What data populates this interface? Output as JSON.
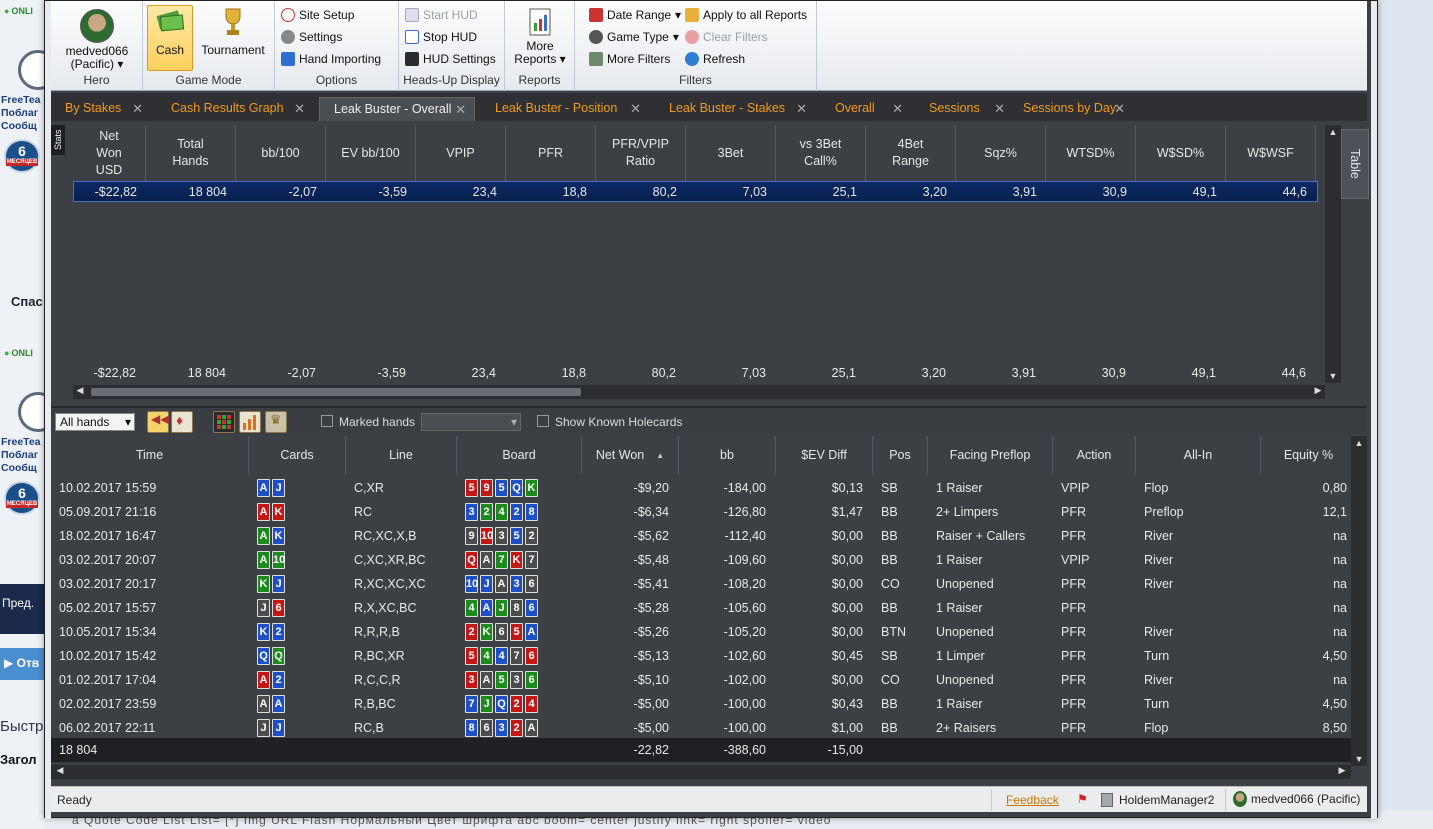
{
  "background": {
    "online": "ONLI",
    "freeteam_lines": [
      "FreeTea",
      "Поблаг",
      "Сообщ"
    ],
    "badge": {
      "num": "6",
      "label": "МЕСЯЦЕВ"
    },
    "spas": "Спас",
    "pred": "Пред.",
    "otv": "Отв",
    "bystr": "Быстр",
    "zagol": "Загол",
    "bottom_bar": "ā   Quote   Code   List   List=   [*]   Img   URL   Flash    Нормальный    Цвет шрифта   abc   boom=   center   justify   link=   right   spoiler=   video"
  },
  "ribbon": {
    "hero": {
      "name": "medved066",
      "site": "(Pacific)",
      "label": "Hero"
    },
    "game_mode": {
      "cash": "Cash",
      "tournament": "Tournament",
      "label": "Game Mode"
    },
    "options": {
      "site_setup": "Site Setup",
      "settings": "Settings",
      "hand_importing": "Hand Importing",
      "label": "Options"
    },
    "hud": {
      "start": "Start HUD",
      "stop": "Stop HUD",
      "settings": "HUD Settings",
      "label": "Heads-Up Display"
    },
    "reports": {
      "more1": "More",
      "more2": "Reports",
      "label": "Reports"
    },
    "filters": {
      "date_range": "Date Range",
      "apply_all": "Apply to all Reports",
      "game_type": "Game Type",
      "clear": "Clear Filters",
      "more": "More Filters",
      "refresh": "Refresh",
      "label": "Filters"
    }
  },
  "tabs": [
    "By Stakes",
    "Cash Results Graph",
    "Leak Buster - Overall",
    "Leak Buster - Position",
    "Leak Buster - Stakes",
    "Overall",
    "Sessions",
    "Sessions by Day"
  ],
  "stats": {
    "side_label": "Stats",
    "table_label": "Table",
    "headers": [
      [
        "Net",
        "Won",
        "USD"
      ],
      [
        "Total",
        "Hands"
      ],
      [
        "bb/100"
      ],
      [
        "EV bb/100"
      ],
      [
        "VPIP"
      ],
      [
        "PFR"
      ],
      [
        "PFR/VPIP",
        "Ratio"
      ],
      [
        "3Bet"
      ],
      [
        "vs 3Bet",
        "Call%"
      ],
      [
        "4Bet",
        "Range"
      ],
      [
        "Sqz%"
      ],
      [
        "WTSD%"
      ],
      [
        "W$SD%"
      ],
      [
        "W$WSF"
      ]
    ],
    "row": [
      "-$22,82",
      "18 804",
      "-2,07",
      "-3,59",
      "23,4",
      "18,8",
      "80,2",
      "7,03",
      "25,1",
      "3,20",
      "3,91",
      "30,9",
      "49,1",
      "44,6"
    ],
    "total": [
      "-$22,82",
      "18 804",
      "-2,07",
      "-3,59",
      "23,4",
      "18,8",
      "80,2",
      "7,03",
      "25,1",
      "3,20",
      "3,91",
      "30,9",
      "49,1",
      "44,6"
    ]
  },
  "hand_toolbar": {
    "filter": "All hands",
    "marked": "Marked hands",
    "known": "Show Known Holecards"
  },
  "hands": {
    "headers": [
      "Time",
      "Cards",
      "Line",
      "Board",
      "Net Won",
      "bb",
      "$EV Diff",
      "Pos",
      "Facing Preflop",
      "Action",
      "All-In",
      "Equity %"
    ],
    "rows": [
      {
        "time": "10.02.2017 15:59",
        "cards": [
          [
            "A",
            "d"
          ],
          [
            "J",
            "d"
          ]
        ],
        "line": "C,XR",
        "board": [
          [
            "5",
            "h"
          ],
          [
            "9",
            "h"
          ],
          [
            "5",
            "d"
          ],
          [
            "Q",
            "d"
          ],
          [
            "K",
            "c"
          ]
        ],
        "net": "-$9,20",
        "bb": "-184,00",
        "ev": "$0,13",
        "pos": "SB",
        "facing": "1 Raiser",
        "action": "VPIP",
        "allin": "Flop",
        "eq": "0,80"
      },
      {
        "time": "05.09.2017 21:16",
        "cards": [
          [
            "A",
            "h"
          ],
          [
            "K",
            "h"
          ]
        ],
        "line": "RC",
        "board": [
          [
            "3",
            "d"
          ],
          [
            "2",
            "c"
          ],
          [
            "4",
            "c"
          ],
          [
            "2",
            "d"
          ],
          [
            "8",
            "d"
          ]
        ],
        "net": "-$6,34",
        "bb": "-126,80",
        "ev": "$1,47",
        "pos": "BB",
        "facing": "2+ Limpers",
        "action": "PFR",
        "allin": "Preflop",
        "eq": "12,1"
      },
      {
        "time": "18.02.2017 16:47",
        "cards": [
          [
            "A",
            "c"
          ],
          [
            "K",
            "d"
          ]
        ],
        "line": "RC,XC,X,B",
        "board": [
          [
            "9",
            "s"
          ],
          [
            "10",
            "h"
          ],
          [
            "3",
            "s"
          ],
          [
            "5",
            "d"
          ],
          [
            "2",
            "s"
          ]
        ],
        "net": "-$5,62",
        "bb": "-112,40",
        "ev": "$0,00",
        "pos": "BB",
        "facing": "Raiser + Callers",
        "action": "PFR",
        "allin": "River",
        "eq": "na"
      },
      {
        "time": "03.02.2017 20:07",
        "cards": [
          [
            "A",
            "c"
          ],
          [
            "10",
            "c"
          ]
        ],
        "line": "C,XC,XR,BC",
        "board": [
          [
            "Q",
            "h"
          ],
          [
            "A",
            "s"
          ],
          [
            "7",
            "c"
          ],
          [
            "K",
            "h"
          ],
          [
            "7",
            "s"
          ]
        ],
        "net": "-$5,48",
        "bb": "-109,60",
        "ev": "$0,00",
        "pos": "BB",
        "facing": "1 Raiser",
        "action": "VPIP",
        "allin": "River",
        "eq": "na"
      },
      {
        "time": "03.02.2017 20:17",
        "cards": [
          [
            "K",
            "c"
          ],
          [
            "J",
            "d"
          ]
        ],
        "line": "R,XC,XC,XC",
        "board": [
          [
            "10",
            "d"
          ],
          [
            "J",
            "d"
          ],
          [
            "A",
            "s"
          ],
          [
            "3",
            "d"
          ],
          [
            "6",
            "s"
          ]
        ],
        "net": "-$5,41",
        "bb": "-108,20",
        "ev": "$0,00",
        "pos": "CO",
        "facing": "Unopened",
        "action": "PFR",
        "allin": "River",
        "eq": "na"
      },
      {
        "time": "05.02.2017 15:57",
        "cards": [
          [
            "J",
            "s"
          ],
          [
            "6",
            "h"
          ]
        ],
        "line": "R,X,XC,BC",
        "board": [
          [
            "4",
            "c"
          ],
          [
            "A",
            "d"
          ],
          [
            "J",
            "c"
          ],
          [
            "8",
            "s"
          ],
          [
            "6",
            "d"
          ]
        ],
        "net": "-$5,28",
        "bb": "-105,60",
        "ev": "$0,00",
        "pos": "BB",
        "facing": "1 Raiser",
        "action": "PFR",
        "allin": "",
        "eq": "na"
      },
      {
        "time": "10.05.2017 15:34",
        "cards": [
          [
            "K",
            "d"
          ],
          [
            "2",
            "d"
          ]
        ],
        "line": "R,R,R,B",
        "board": [
          [
            "2",
            "h"
          ],
          [
            "K",
            "c"
          ],
          [
            "6",
            "s"
          ],
          [
            "5",
            "h"
          ],
          [
            "A",
            "d"
          ]
        ],
        "net": "-$5,26",
        "bb": "-105,20",
        "ev": "$0,00",
        "pos": "BTN",
        "facing": "Unopened",
        "action": "PFR",
        "allin": "River",
        "eq": "na"
      },
      {
        "time": "10.02.2017 15:42",
        "cards": [
          [
            "Q",
            "d"
          ],
          [
            "Q",
            "c"
          ]
        ],
        "line": "R,BC,XR",
        "board": [
          [
            "5",
            "h"
          ],
          [
            "4",
            "c"
          ],
          [
            "4",
            "d"
          ],
          [
            "7",
            "s"
          ],
          [
            "6",
            "h"
          ]
        ],
        "net": "-$5,13",
        "bb": "-102,60",
        "ev": "$0,45",
        "pos": "SB",
        "facing": "1 Limper",
        "action": "PFR",
        "allin": "Turn",
        "eq": "4,50"
      },
      {
        "time": "01.02.2017 17:04",
        "cards": [
          [
            "A",
            "h"
          ],
          [
            "2",
            "d"
          ]
        ],
        "line": "R,C,C,R",
        "board": [
          [
            "3",
            "h"
          ],
          [
            "A",
            "s"
          ],
          [
            "5",
            "c"
          ],
          [
            "3",
            "s"
          ],
          [
            "6",
            "c"
          ]
        ],
        "net": "-$5,10",
        "bb": "-102,00",
        "ev": "$0,00",
        "pos": "CO",
        "facing": "Unopened",
        "action": "PFR",
        "allin": "River",
        "eq": "na"
      },
      {
        "time": "02.02.2017 23:59",
        "cards": [
          [
            "A",
            "s"
          ],
          [
            "A",
            "d"
          ]
        ],
        "line": "R,B,BC",
        "board": [
          [
            "7",
            "d"
          ],
          [
            "J",
            "c"
          ],
          [
            "Q",
            "d"
          ],
          [
            "2",
            "h"
          ],
          [
            "4",
            "h"
          ]
        ],
        "net": "-$5,00",
        "bb": "-100,00",
        "ev": "$0,43",
        "pos": "BB",
        "facing": "1 Raiser",
        "action": "PFR",
        "allin": "Turn",
        "eq": "4,50"
      },
      {
        "time": "06.02.2017 22:11",
        "cards": [
          [
            "J",
            "s"
          ],
          [
            "J",
            "d"
          ]
        ],
        "line": "RC,B",
        "board": [
          [
            "8",
            "d"
          ],
          [
            "6",
            "s"
          ],
          [
            "3",
            "d"
          ],
          [
            "2",
            "h"
          ],
          [
            "A",
            "s"
          ]
        ],
        "net": "-$5,00",
        "bb": "-100,00",
        "ev": "$1,00",
        "pos": "BB",
        "facing": "2+ Raisers",
        "action": "PFR",
        "allin": "Flop",
        "eq": "8,50"
      }
    ],
    "totals": {
      "count": "18 804",
      "net": "-22,82",
      "bb": "-388,60",
      "ev": "-15,00"
    }
  },
  "status": {
    "ready": "Ready",
    "feedback": "Feedback",
    "app": "HoldemManager2",
    "user": "medved066 (Pacific)"
  },
  "colors": {
    "accent_tab": "#f39a1c",
    "negative": "#ff6b6b",
    "positive": "#5fe35f",
    "selected_row": "#0c2a66"
  }
}
